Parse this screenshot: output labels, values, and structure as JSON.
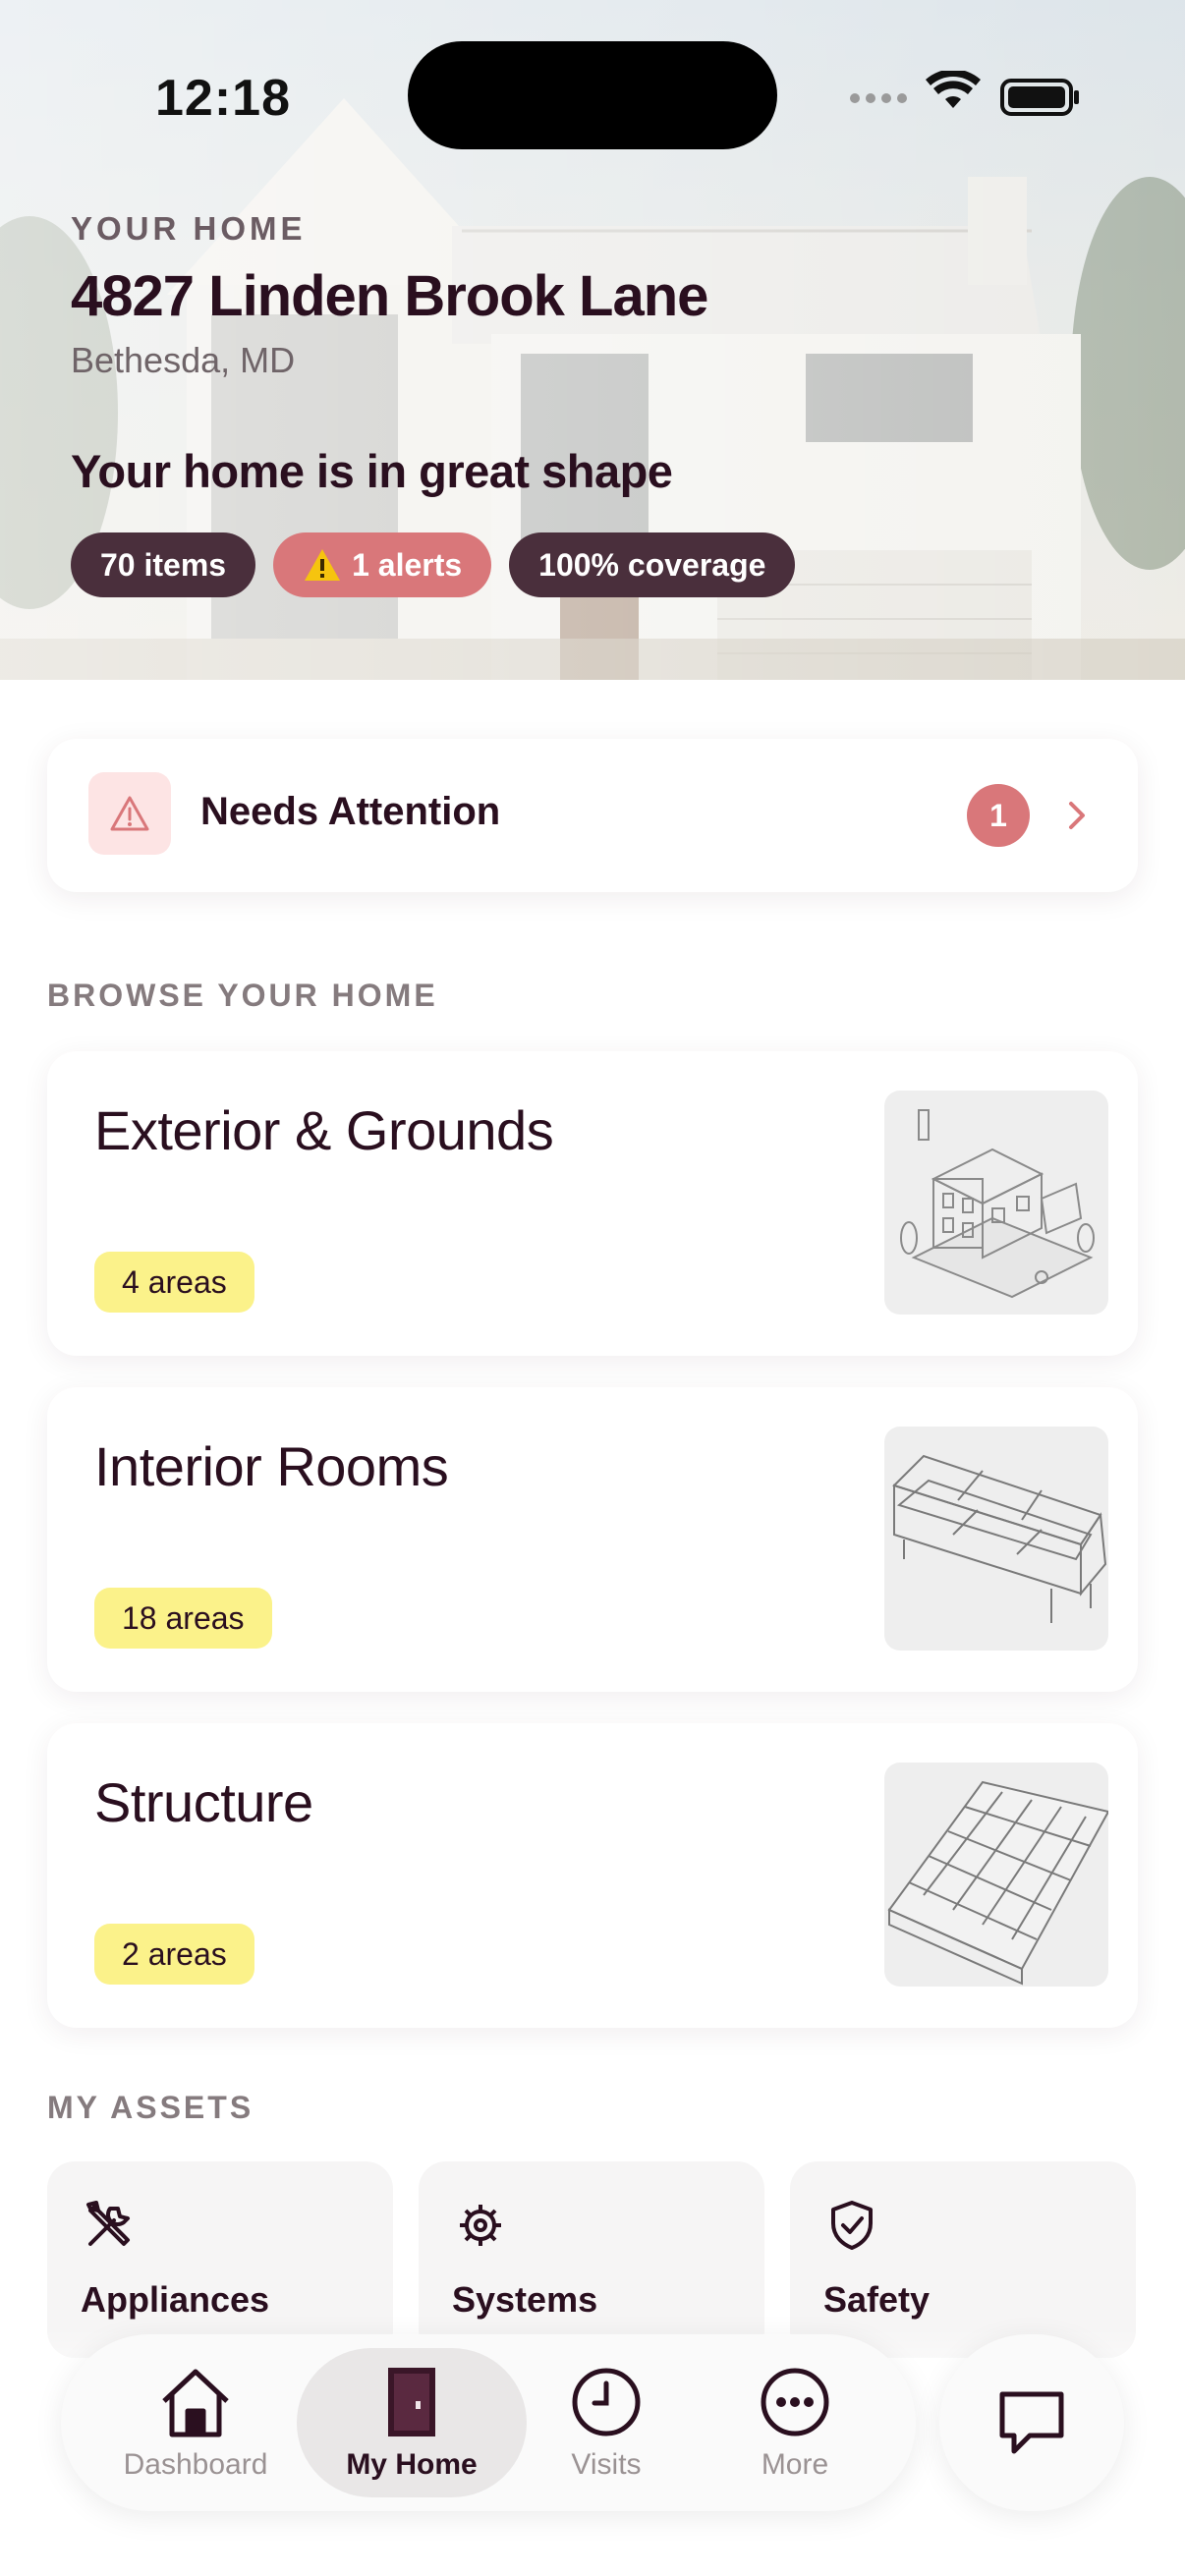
{
  "status_bar": {
    "time": "12:18"
  },
  "hero": {
    "eyebrow": "YOUR HOME",
    "address": "4827 Linden Brook Lane",
    "location": "Bethesda, MD",
    "status_message": "Your home is in great shape",
    "pills": [
      {
        "label": "70 items",
        "color": "#4a2f3c"
      },
      {
        "label": "1 alerts",
        "color": "#d9777a",
        "icon": "warning-icon"
      },
      {
        "label": "100% coverage",
        "color": "#4a2f3c"
      }
    ]
  },
  "needs_attention": {
    "label": "Needs Attention",
    "count": "1",
    "icon": "warning-triangle-icon"
  },
  "browse": {
    "section_title": "BROWSE YOUR HOME",
    "cards": [
      {
        "title": "Exterior & Grounds",
        "areas": "4 areas",
        "image": "house-illustration"
      },
      {
        "title": "Interior Rooms",
        "areas": "18 areas",
        "image": "sofa-illustration"
      },
      {
        "title": "Structure",
        "areas": "2 areas",
        "image": "roof-shingles-illustration"
      }
    ]
  },
  "assets": {
    "section_title": "MY ASSETS",
    "items": [
      {
        "label": "Appliances",
        "icon": "tools-icon"
      },
      {
        "label": "Systems",
        "icon": "gear-icon"
      },
      {
        "label": "Safety",
        "icon": "shield-check-icon"
      }
    ]
  },
  "nav": {
    "items": [
      {
        "label": "Dashboard",
        "icon": "house-icon"
      },
      {
        "label": "My Home",
        "icon": "door-icon",
        "active": true
      },
      {
        "label": "Visits",
        "icon": "clock-icon"
      },
      {
        "label": "More",
        "icon": "more-icon"
      }
    ],
    "chat_icon": "chat-bubble-icon"
  },
  "colors": {
    "primary": "#2a0f1f",
    "alert": "#d9777a",
    "tag": "#fbf28a",
    "pill": "#4a2f3c"
  }
}
